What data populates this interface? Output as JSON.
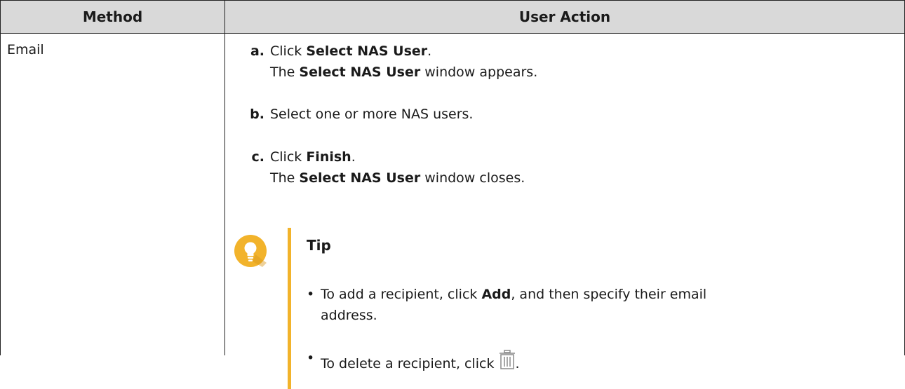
{
  "table": {
    "headers": {
      "method": "Method",
      "action": "User Action"
    },
    "method": "Email",
    "steps": [
      {
        "marker": "a.",
        "parts": [
          "Click ",
          "Select NAS User",
          "."
        ],
        "line2_parts": [
          "The ",
          "Select NAS User",
          " window appears."
        ]
      },
      {
        "marker": "b.",
        "parts": [
          "Select one or more NAS users."
        ]
      },
      {
        "marker": "c.",
        "parts": [
          "Click ",
          "Finish",
          "."
        ],
        "line2_parts": [
          "The ",
          "Select NAS User",
          " window closes."
        ]
      }
    ],
    "tip": {
      "title": "Tip",
      "icon": "lightbulb-icon",
      "bullets": [
        {
          "parts": [
            "To add a recipient, click ",
            "Add",
            ", and then specify their email"
          ],
          "line2": "address."
        },
        {
          "parts": [
            "To delete a recipient, click "
          ],
          "icon": "trash-icon",
          "end": "."
        }
      ]
    }
  },
  "colors": {
    "accent": "#f2b32b",
    "header_bg": "#d9d9d9",
    "border": "#222222"
  }
}
